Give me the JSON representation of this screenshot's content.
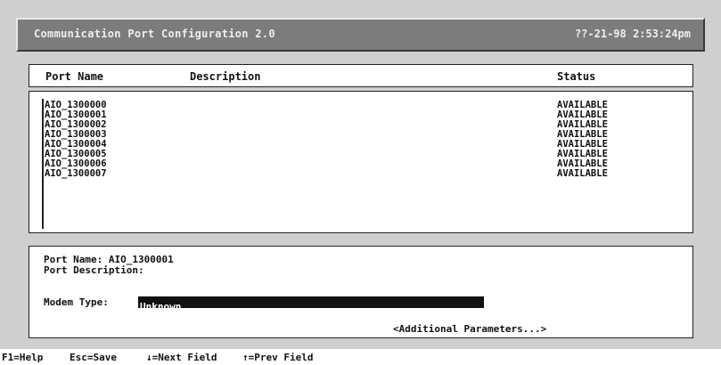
{
  "titlebar": {
    "title": "Communication Port Configuration  2.0",
    "datetime": "??-21-98 2:53:24pm"
  },
  "list": {
    "headers": {
      "name": "Port Name",
      "description": "Description",
      "status": "Status"
    },
    "rows": [
      {
        "name": "AIO_1300000",
        "description": "",
        "status": "AVAILABLE"
      },
      {
        "name": "AIO_1300001",
        "description": "",
        "status": "AVAILABLE"
      },
      {
        "name": "AIO_1300002",
        "description": "",
        "status": "AVAILABLE"
      },
      {
        "name": "AIO_1300003",
        "description": "",
        "status": "AVAILABLE"
      },
      {
        "name": "AIO_1300004",
        "description": "",
        "status": "AVAILABLE"
      },
      {
        "name": "AIO_1300005",
        "description": "",
        "status": "AVAILABLE"
      },
      {
        "name": "AIO_1300006",
        "description": "",
        "status": "AVAILABLE"
      },
      {
        "name": "AIO_1300007",
        "description": "",
        "status": "AVAILABLE"
      }
    ]
  },
  "details": {
    "port_name_label": "Port Name: AIO_1300001",
    "port_description_label": "Port Description:",
    "modem_type_label": "Modem Type:",
    "modem_type_value": "Unknown",
    "additional_parameters": "<Additional Parameters...>"
  },
  "fkeys": {
    "help": "F1=Help",
    "save": "Esc=Save",
    "next": "↓=Next Field",
    "prev": "↑=Prev Field"
  }
}
